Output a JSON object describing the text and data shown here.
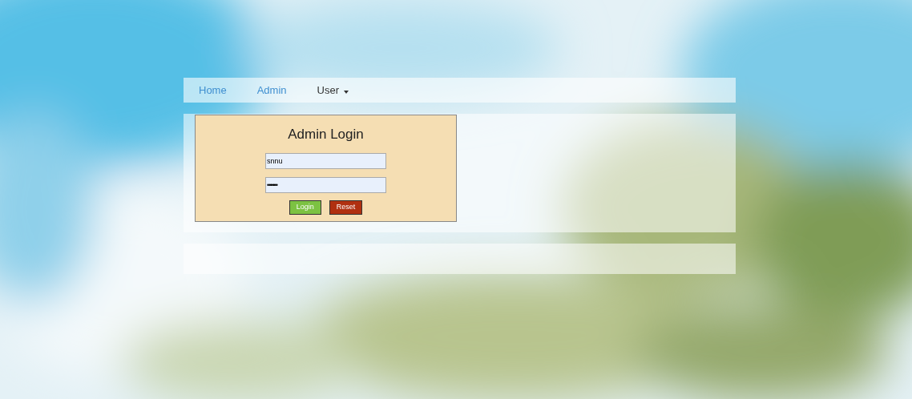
{
  "nav": {
    "items": [
      {
        "label": "Home",
        "kind": "link"
      },
      {
        "label": "Admin",
        "kind": "link"
      },
      {
        "label": "User",
        "kind": "dropdown"
      }
    ]
  },
  "login": {
    "title": "Admin Login",
    "fields": [
      {
        "kind": "text",
        "value": "snnu"
      },
      {
        "kind": "password",
        "value": "••••••"
      }
    ],
    "buttons": [
      {
        "label": "Login",
        "kind": "primary"
      },
      {
        "label": "Reset",
        "kind": "danger"
      }
    ]
  }
}
